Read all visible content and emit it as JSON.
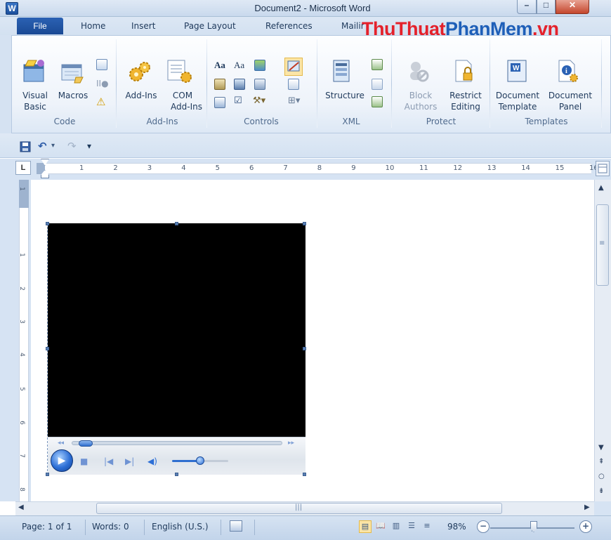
{
  "window": {
    "app_icon": "W",
    "title": "Document2 - Microsoft Word",
    "minimize_glyph": "–",
    "maximize_glyph": "□",
    "close_glyph": "✕"
  },
  "tabs": {
    "file": "File",
    "items": [
      "Home",
      "Insert",
      "Page Layout",
      "References",
      "Mailings"
    ]
  },
  "watermark": {
    "part1": "ThuThuat",
    "part2": "PhanMem",
    "part3": ".vn"
  },
  "ribbon": {
    "code": {
      "label": "Code",
      "visual_basic": [
        "Visual",
        "Basic"
      ],
      "macros": "Macros"
    },
    "addins": {
      "label": "Add-Ins",
      "addins_btn": "Add-Ins",
      "com_addins": [
        "COM",
        "Add-Ins"
      ]
    },
    "controls": {
      "label": "Controls",
      "aa1": "Aa",
      "aa2": "Aa"
    },
    "xml": {
      "label": "XML",
      "structure": "Structure"
    },
    "protect": {
      "label": "Protect",
      "block_authors": [
        "Block",
        "Authors"
      ],
      "restrict_editing": [
        "Restrict",
        "Editing"
      ]
    },
    "templates": {
      "label": "Templates",
      "document_template": [
        "Document",
        "Template"
      ],
      "document_panel": [
        "Document",
        "Panel"
      ]
    }
  },
  "qat": {
    "save": "save-icon",
    "undo": "undo-icon",
    "redo": "redo-icon",
    "customize": "▾"
  },
  "ruler": {
    "tab_selector": "L",
    "numbers": [
      "1",
      "2",
      "3",
      "4",
      "5",
      "6",
      "7",
      "8",
      "9",
      "10",
      "11",
      "12",
      "13",
      "14",
      "15",
      "16"
    ],
    "vertical_numbers": [
      "1",
      "1",
      "2",
      "3",
      "4",
      "5",
      "6",
      "7",
      "8"
    ]
  },
  "status": {
    "page": "Page: 1 of 1",
    "words": "Words: 0",
    "language": "English (U.S.)",
    "zoom": "98%",
    "zoom_minus": "−",
    "zoom_plus": "+"
  },
  "player": {
    "progress": 0.03,
    "volume": 0.5
  }
}
